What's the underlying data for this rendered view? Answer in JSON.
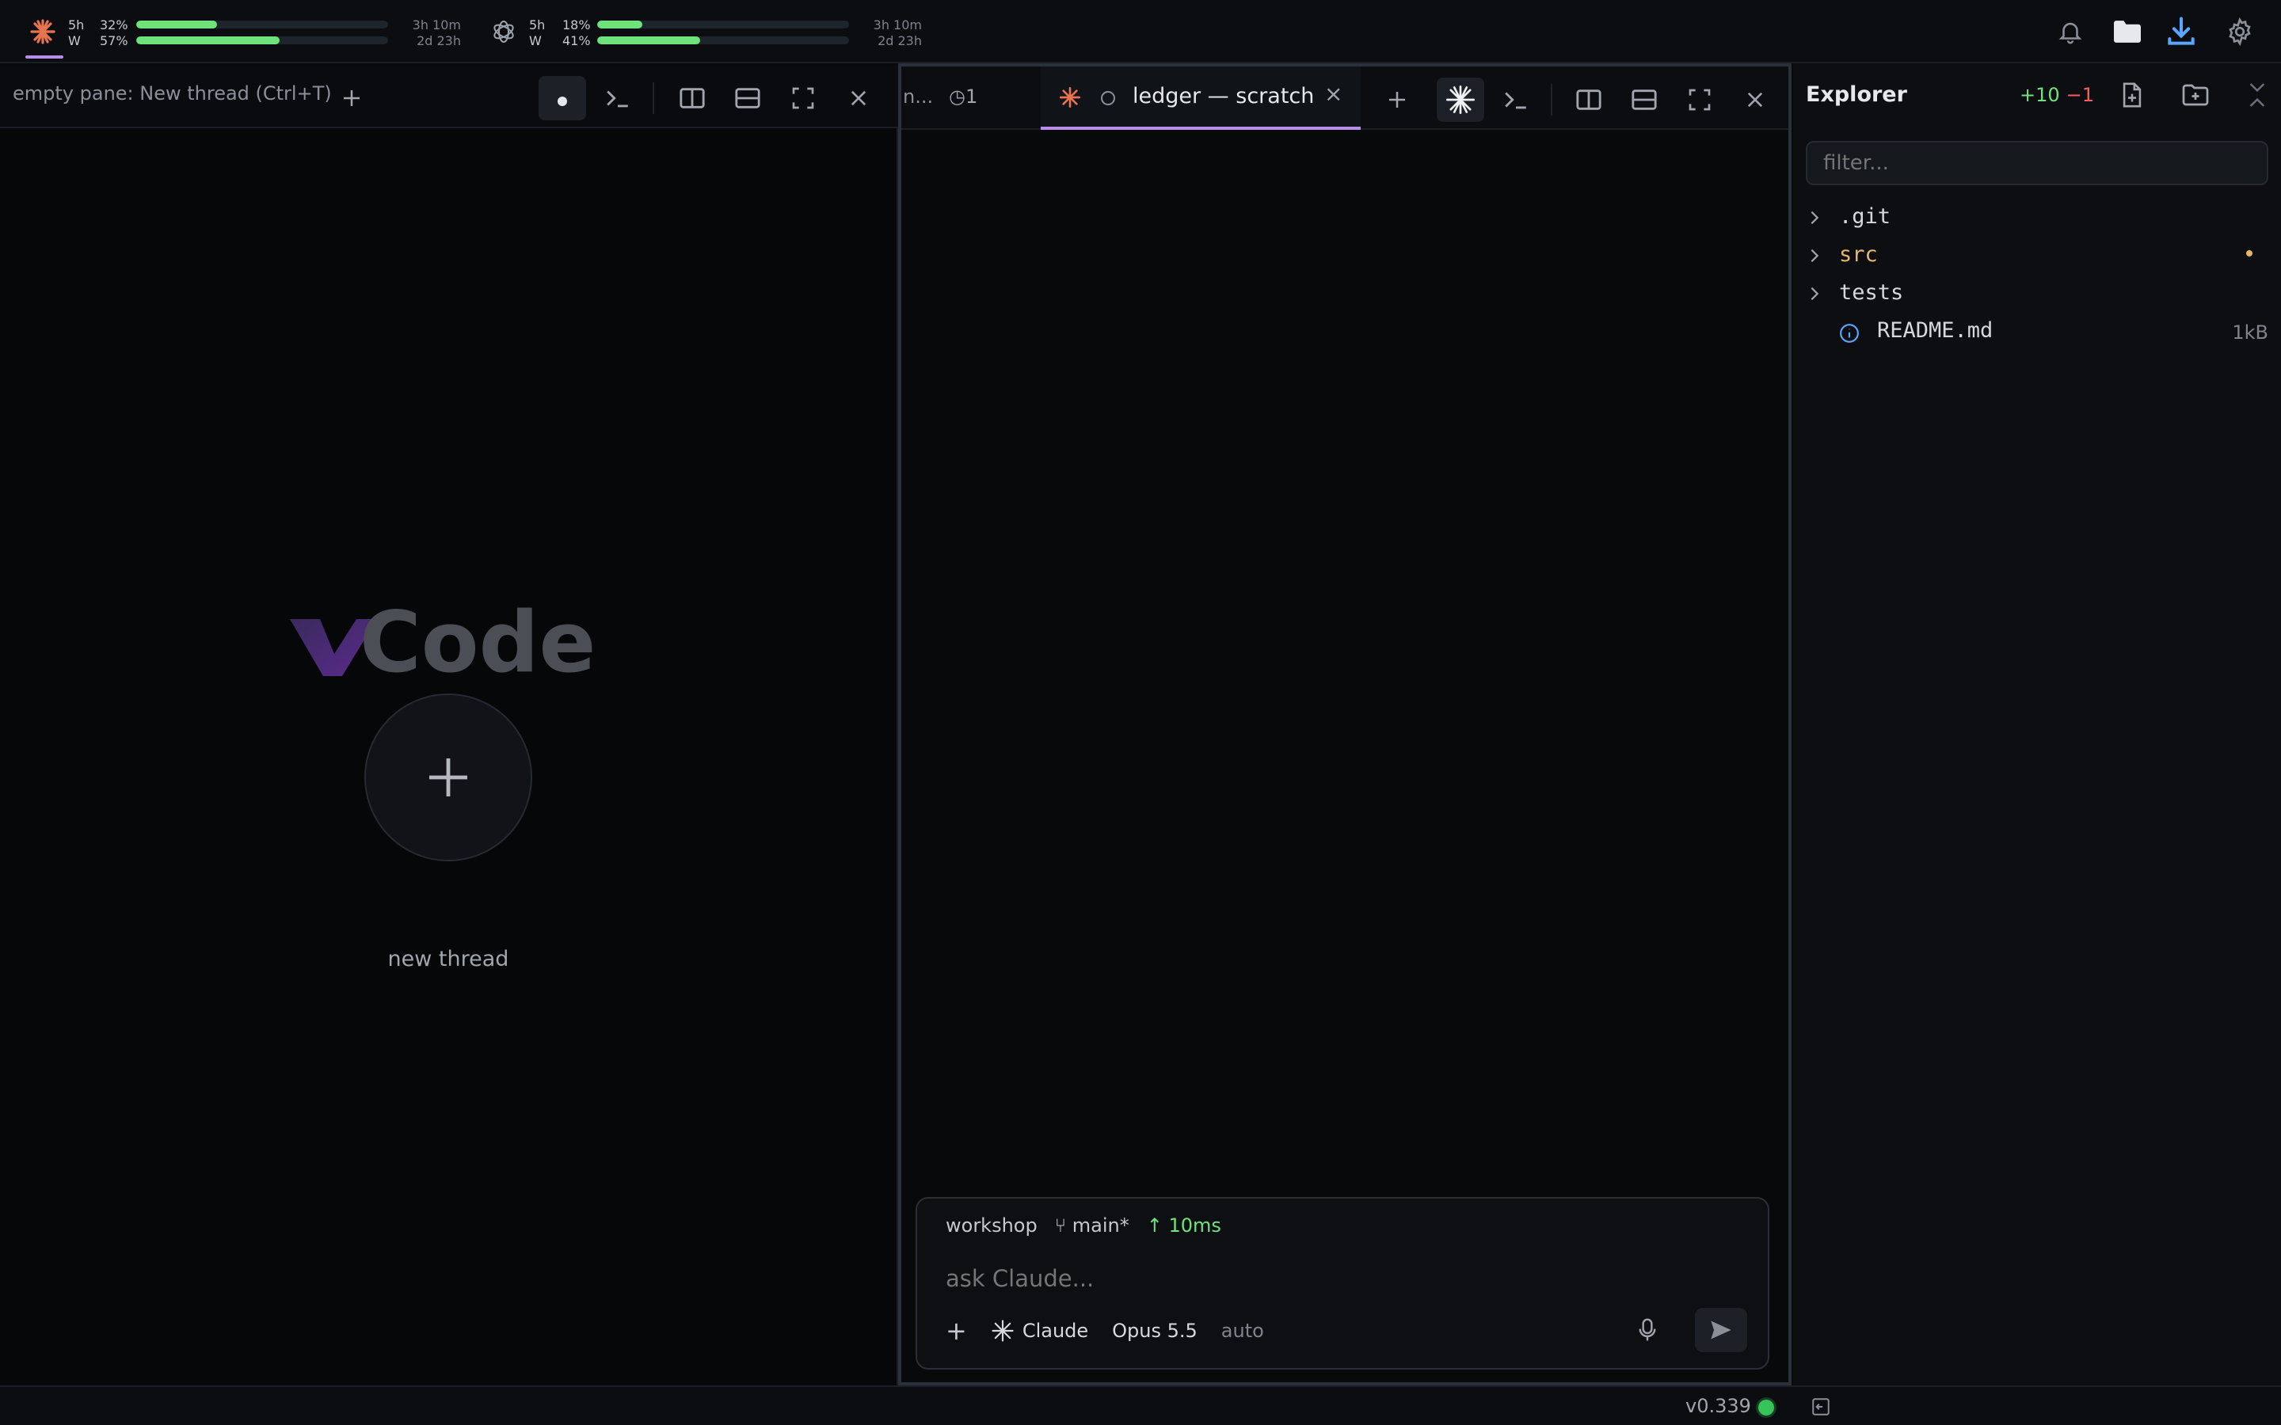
{
  "usage": [
    {
      "provider_icon": "claude-icon",
      "window_label": "5h",
      "week_label": "W",
      "window_pct_label": "32%",
      "week_pct_label": "57%",
      "window_fill": 0.32,
      "week_fill": 0.57,
      "window_reset": "3h 10m",
      "week_reset": "2d 23h"
    },
    {
      "provider_icon": "openai-icon",
      "window_label": "5h",
      "week_label": "W",
      "window_pct_label": "18%",
      "week_pct_label": "41%",
      "window_fill": 0.18,
      "week_fill": 0.41,
      "window_reset": "3h 10m",
      "week_reset": "2d 23h"
    }
  ],
  "top_icons": [
    "bell-icon",
    "folder-icon",
    "download-icon",
    "gear-icon"
  ],
  "left_pane": {
    "header_label": "empty pane: New thread (Ctrl+T)",
    "logo_text": "vCode",
    "new_thread_label": "new thread"
  },
  "right_pane": {
    "truncated_tab": "n...",
    "history_tab": "◷1",
    "active_tab": "ledger — scratch",
    "composer": {
      "workspace": "workshop",
      "branch": "⑂ main*",
      "latency": "↑ 10ms",
      "placeholder": "ask Claude...",
      "agent": "Claude",
      "model": "Opus 5.5",
      "mode": "auto"
    }
  },
  "explorer": {
    "title": "Explorer",
    "added": "+10",
    "removed": "−1",
    "filter_placeholder": "filter...",
    "items": [
      {
        "name": ".git",
        "type": "folder"
      },
      {
        "name": "src",
        "type": "folder",
        "modified": true
      },
      {
        "name": "tests",
        "type": "folder"
      },
      {
        "name": "README.md",
        "type": "file",
        "size": "1kB"
      }
    ]
  },
  "status": {
    "version": "v0.339"
  },
  "colors": {
    "accent": "#b98ce8",
    "usage_fill": "#6ee37b",
    "modified": "#e8b86a",
    "online": "#36c45a",
    "diff_add": "#6ee37b",
    "diff_del": "#ff5c5c"
  }
}
